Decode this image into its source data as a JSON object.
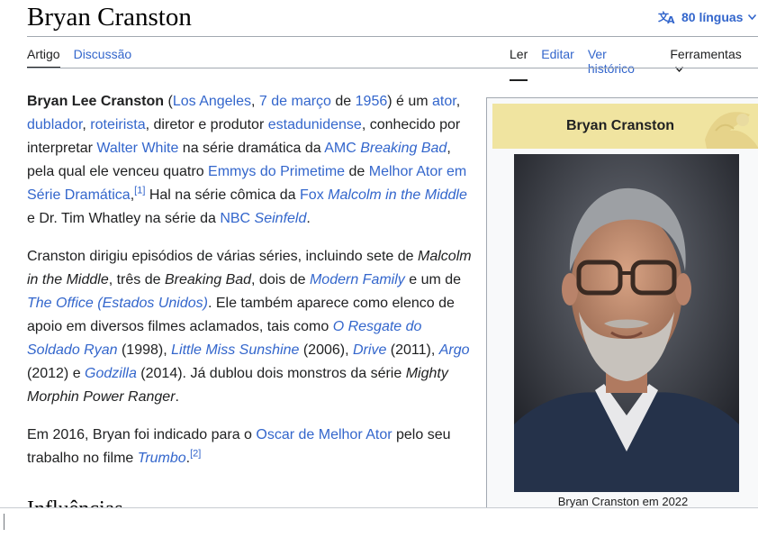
{
  "page": {
    "title": "Bryan Cranston",
    "languages_label": "80 línguas",
    "tabs_left": [
      "Artigo",
      "Discussão"
    ],
    "tabs_right": [
      "Ler",
      "Editar",
      "Ver histórico",
      "Ferramentas"
    ],
    "section_heading": "Influências"
  },
  "article": {
    "p1": {
      "b_name": "Bryan Lee Cranston",
      "t1": " (",
      "l_la": "Los Angeles",
      "t2": ", ",
      "l_date": "7 de março",
      "t3": " de ",
      "l_year": "1956",
      "t4": ") é um ",
      "l_ator": "ator",
      "t5": ", ",
      "l_dublador": "dublador",
      "t6": ", ",
      "l_roteirista": "roteirista",
      "t7": ", diretor e produtor ",
      "l_estadunidense": "estadunidense",
      "t8": ", conhecido por interpretar ",
      "l_ww": "Walter White",
      "t9": " na série dramática da ",
      "l_amc": "AMC",
      "t10": " ",
      "l_bb": "Breaking Bad",
      "t11": ", pela qual ele venceu quatro ",
      "l_emmys": "Emmys do Primetime",
      "t12": " de ",
      "l_melhor": "Melhor Ator em Série Dramática",
      "t13": ",",
      "ref1": "[1]",
      "t14": " Hal na série cômica da ",
      "l_fox": "Fox",
      "t15": " ",
      "l_malcolm": "Malcolm in the Middle",
      "t16": " e Dr. Tim Whatley na série da ",
      "l_nbc": "NBC",
      "t17": " ",
      "l_seinfeld": "Seinfeld",
      "t18": "."
    },
    "p2": {
      "t1": "Cranston dirigiu episódios de várias séries, incluindo sete de ",
      "i_malcolm": "Malcolm in the Middle",
      "t2": ", três de ",
      "i_bb": "Breaking Bad",
      "t3": ", dois de ",
      "l_mf": "Modern Family",
      "t4": " e um de ",
      "l_office": "The Office (Estados Unidos)",
      "t5": ". Ele também aparece como elenco de apoio em diversos filmes aclamados, tais como ",
      "l_ryan": "O Resgate do Soldado Ryan",
      "t6": " (1998), ",
      "l_lms": "Little Miss Sunshine",
      "t7": " (2006), ",
      "l_drive": "Drive",
      "t8": " (2011), ",
      "l_argo": "Argo",
      "t9": " (2012) e ",
      "l_godzilla": "Godzilla",
      "t10": " (2014). Já dublou dois monstros da série ",
      "i_mighty": "Mighty Morphin Power Ranger",
      "t11": "."
    },
    "p3": {
      "t1": "Em 2016, Bryan foi indicado para o ",
      "l_oscar": "Oscar de Melhor Ator",
      "t2": " pelo seu trabalho no filme ",
      "l_trumbo": "Trumbo",
      "t3": ".",
      "ref2": "[2]"
    }
  },
  "infobox": {
    "title": "Bryan Cranston",
    "caption": "Bryan Cranston em 2022"
  },
  "icons": [
    "translate-icon",
    "chevron-down-icon"
  ]
}
